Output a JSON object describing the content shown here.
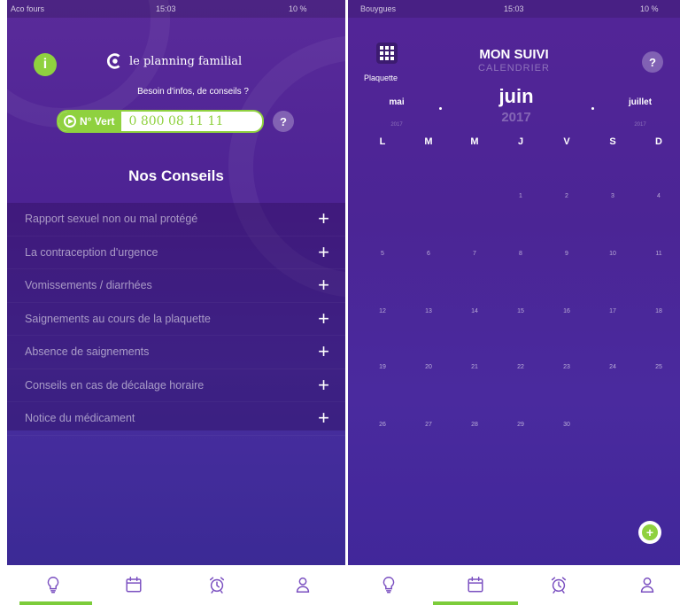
{
  "left": {
    "status": {
      "carrier": "Aco fours",
      "time": "15:03",
      "battery": "10 %"
    },
    "brand": "le planning familial",
    "help_text": "Besoin d'infos, de conseils ?",
    "phone": {
      "label": "N° Vert",
      "number": "0 800 08 11 11"
    },
    "section_title": "Nos Conseils",
    "advice": [
      "Rapport sexuel non ou mal protégé",
      "La contraception d'urgence",
      "Vomissements / diarrhées",
      "Saignements au cours de la plaquette",
      "Absence de saignements",
      "Conseils en cas de décalage horaire",
      "Notice du médicament"
    ],
    "info_icon": "i",
    "help_icon": "?",
    "plus_icon": "+"
  },
  "right": {
    "status": {
      "carrier": "Bouygues",
      "time": "15:03",
      "battery": "10 %"
    },
    "plaquette_label": "Plaquette",
    "title": "MON SUIVI",
    "subtitle": "CALENDRIER",
    "prev_month": {
      "name": "mai",
      "year": "2017"
    },
    "current_month": {
      "name": "juin",
      "year": "2017"
    },
    "next_month": {
      "name": "juillet",
      "year": "2017"
    },
    "weekdays": [
      "L",
      "M",
      "M",
      "J",
      "V",
      "S",
      "D"
    ],
    "weeks": [
      [
        "",
        "",
        "",
        "1",
        "2",
        "3",
        "4"
      ],
      [
        "5",
        "6",
        "7",
        "8",
        "9",
        "10",
        "11"
      ],
      [
        "12",
        "13",
        "14",
        "15",
        "16",
        "17",
        "18"
      ],
      [
        "19",
        "20",
        "21",
        "22",
        "23",
        "24",
        "25"
      ],
      [
        "26",
        "27",
        "28",
        "29",
        "30",
        "",
        ""
      ]
    ],
    "help_icon": "?",
    "add_icon": "+"
  },
  "tabs": [
    "lightbulb-icon",
    "calendar-icon",
    "alarm-clock-icon",
    "user-icon"
  ],
  "colors": {
    "accent": "#8fd13f",
    "background": "#4d2394",
    "underline": "#7ccc3a",
    "tab_icon": "#7a4fc0"
  }
}
